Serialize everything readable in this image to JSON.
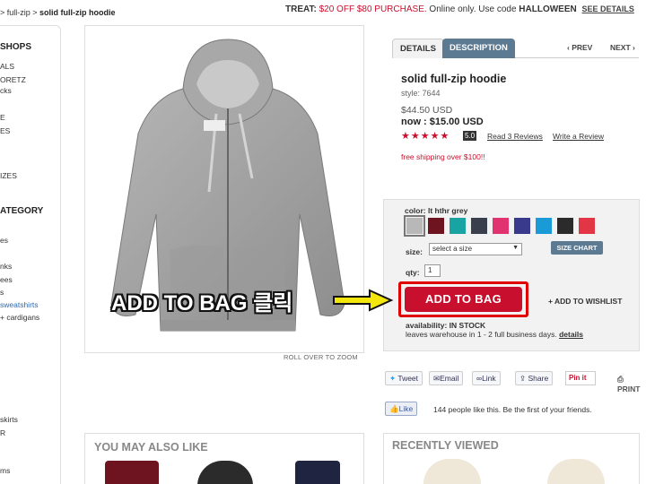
{
  "breadcrumb": {
    "prefix": "> full-zip > ",
    "current": "solid full-zip hoodie"
  },
  "promo": {
    "label": "TREAT:",
    "offer": "$20 OFF $80 PURCHASE.",
    "middle": "Online only. Use code",
    "code": "HALLOWEEN",
    "link": "SEE DETAILS"
  },
  "sidebar": {
    "heading_shops": "SHOPS",
    "shops": [
      "ALS",
      "ORETZ",
      "cks",
      "E",
      "ES"
    ],
    "sizes_item": "IZES",
    "heading_category": "ATEGORY",
    "categories": [
      "es",
      "nks",
      "ees",
      "s",
      "sweatshirts",
      "+ cardigans",
      "skirts",
      "R",
      "ms"
    ]
  },
  "image": {
    "zoom_note": "ROLL OVER TO ZOOM"
  },
  "tabs": {
    "details": "DETAILS",
    "description": "DESCRIPTION",
    "prev": "‹ PREV",
    "next": "NEXT ›"
  },
  "product": {
    "title": "solid full-zip hoodie",
    "style": "style: 7644",
    "price": "$44.50 USD",
    "now": "now : $15.00 USD",
    "stars": "★★★★★",
    "rating": "5.0",
    "reviews_link": "Read 3 Reviews",
    "write_link": "Write a Review",
    "shipping": "free shipping over $100!!"
  },
  "options": {
    "color_label": "color: lt hthr grey",
    "swatches": [
      "#b8b8b8",
      "#6e1420",
      "#1aa3a3",
      "#3a3f4e",
      "#e0336f",
      "#3a3a8c",
      "#1a9ad6",
      "#2b2b2b",
      "#e23545"
    ],
    "size_label": "size:",
    "size_placeholder": "select a size",
    "size_chart": "SIZE CHART",
    "qty_label": "qty:",
    "qty_value": "1"
  },
  "actions": {
    "add_to_bag": "ADD TO BAG",
    "wishlist": "+ ADD TO WISHLIST",
    "availability": "availability: IN STOCK",
    "leaves": "leaves warehouse in 1 - 2 full business days.",
    "details_link": "details"
  },
  "annotation": {
    "text": "ADD TO BAG 클릭"
  },
  "social": {
    "tweet": "Tweet",
    "email": "Email",
    "link": "Link",
    "share": "Share",
    "pinit": "Pin it",
    "print": "PRINT",
    "like": "Like",
    "like_count": "144 people like this. Be the first of your friends."
  },
  "sections": {
    "also_like": "YOU MAY ALSO LIKE",
    "recently_viewed": "RECENTLY VIEWED"
  },
  "colors": {
    "accent_red": "#c8102e",
    "tab_blue": "#5d7a93"
  }
}
